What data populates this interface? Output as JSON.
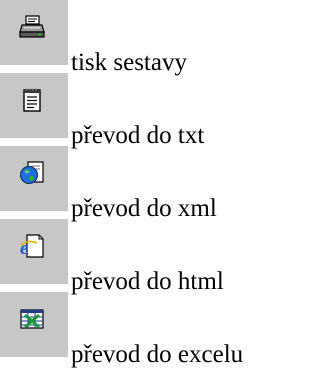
{
  "actions": [
    {
      "label": "tisk sestavy",
      "icon": "printer-icon"
    },
    {
      "label": "převod do txt",
      "icon": "notepad-icon"
    },
    {
      "label": "převod do xml",
      "icon": "globe-document-icon"
    },
    {
      "label": "převod do html",
      "icon": "ie-document-icon"
    },
    {
      "label": "převod do excelu",
      "icon": "excel-icon"
    }
  ],
  "colors": {
    "button_face": "#c7c7c7",
    "text": "#000000",
    "background": "#ffffff"
  }
}
